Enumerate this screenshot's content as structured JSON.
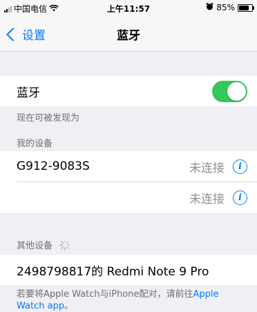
{
  "status_bar": {
    "carrier": "中国电信",
    "time": "上午11:57",
    "battery_percent": "85%",
    "battery_level": 0.85,
    "wifi_icon": "wifi-icon",
    "alarm_icon": "alarm-icon"
  },
  "nav": {
    "back_label": "设置",
    "title": "蓝牙"
  },
  "bluetooth": {
    "label": "蓝牙",
    "enabled": true,
    "discoverable_text": "现在可被发现为"
  },
  "my_devices": {
    "header": "我的设备",
    "items": [
      {
        "name": "G912-9083S",
        "status": "未连接"
      },
      {
        "name": "",
        "status": "未连接"
      }
    ]
  },
  "other_devices": {
    "header": "其他设备",
    "items": [
      {
        "name": "2498798817的 Redmi Note 9 Pro"
      }
    ]
  },
  "footer": {
    "text": "若要将Apple Watch与iPhone配对，请前往",
    "link": "Apple Watch app",
    "suffix": "。"
  },
  "colors": {
    "accent": "#007aff",
    "toggle_on": "#34c759",
    "background": "#efeff4"
  }
}
